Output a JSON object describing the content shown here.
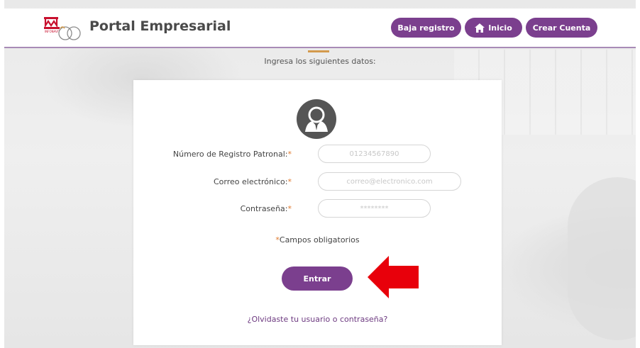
{
  "header": {
    "title": "Portal Empresarial",
    "logo_icon": "infonavit-logo",
    "buttons": [
      {
        "label": "Baja registro"
      },
      {
        "label": "Inicio",
        "icon": "home-icon"
      },
      {
        "label": "Crear Cuenta"
      }
    ]
  },
  "intro": "Ingresa los siguientes datos:",
  "form": {
    "avatar_icon": "user-avatar-icon",
    "fields": [
      {
        "label": "Número de Registro Patronal:",
        "required_mark": "*",
        "placeholder": "01234567890"
      },
      {
        "label": "Correo electrónico:",
        "required_mark": "*",
        "placeholder": "correo@electronico.com"
      },
      {
        "label": "Contraseña:",
        "required_mark": "*",
        "placeholder": "********"
      }
    ],
    "required_note_mark": "*",
    "required_note": "Campos obligatorios",
    "submit_label": "Entrar",
    "forgot_link": "¿Olvidaste tu usuario o contraseña?"
  },
  "annotation": {
    "icon": "red-arrow-icon",
    "color": "#e8000b"
  },
  "colors": {
    "primary": "#7b3f8e",
    "accent": "#d39a4d",
    "required": "#e07a2e"
  }
}
